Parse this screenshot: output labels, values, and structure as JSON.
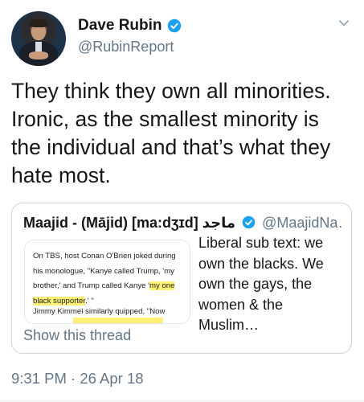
{
  "author": {
    "display_name": "Dave Rubin",
    "handle": "@RubinReport",
    "verified_icon": "verified-badge-icon"
  },
  "tweet": {
    "text": "They think they own all minorities. Ironic, as the smallest minority is the individual and that’s what they hate most.",
    "timestamp": "9:31 PM · 26 Apr 18"
  },
  "quoted_tweet": {
    "display_name": "Maajid - (Mājid) [ma:dʒɪd] ماجد",
    "handle": "@MaajidNa…",
    "body": "Liberal sub text: we own the blacks. We own the gays, the women & the Muslim…",
    "show_thread_label": "Show this thread",
    "media_text": {
      "line1": "On TBS, host Conan O'Brien joked during",
      "line2": "his monologue, \"Kanye called Trump, 'my",
      "line3_pre": "brother,' and Trump called Kanye '",
      "line3_hl": "my one",
      "line4_hl": "black supporter",
      "line4_post": ".' \"",
      "line5": "Jimmy Kimmel similarly quipped, \"Now"
    }
  },
  "colors": {
    "text_primary": "#14171a",
    "text_secondary": "#657786",
    "verified_blue": "#1da1f2",
    "highlight": "#fff176",
    "border": "#ccd6dd"
  }
}
